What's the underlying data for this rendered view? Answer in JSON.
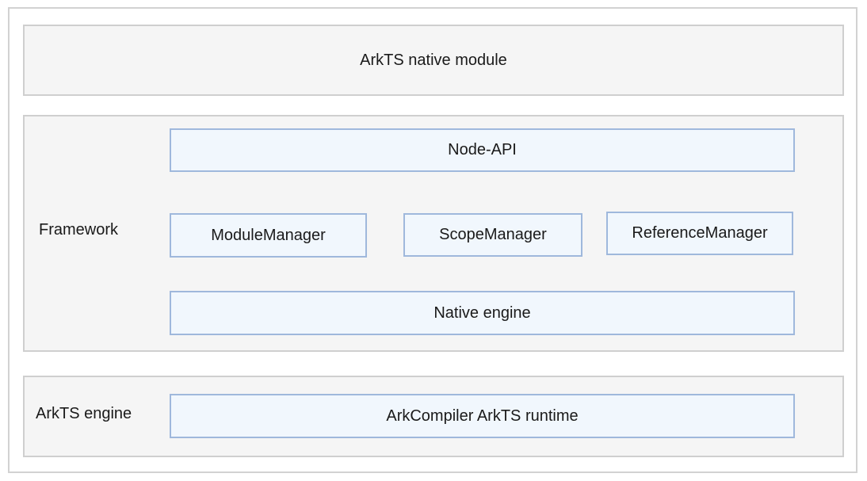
{
  "top_layer": {
    "title": "ArkTS native module"
  },
  "framework_layer": {
    "label": "Framework",
    "node_api": "Node-API",
    "module_manager": "ModuleManager",
    "scope_manager": "ScopeManager",
    "reference_manager": "ReferenceManager",
    "native_engine": "Native engine"
  },
  "engine_layer": {
    "label": "ArkTS engine",
    "runtime": "ArkCompiler ArkTS runtime"
  },
  "colors": {
    "layer_fill": "#f5f5f5",
    "layer_border": "#cfcfcf",
    "box_fill": "#f1f7fd",
    "box_border": "#9fb8dc"
  }
}
